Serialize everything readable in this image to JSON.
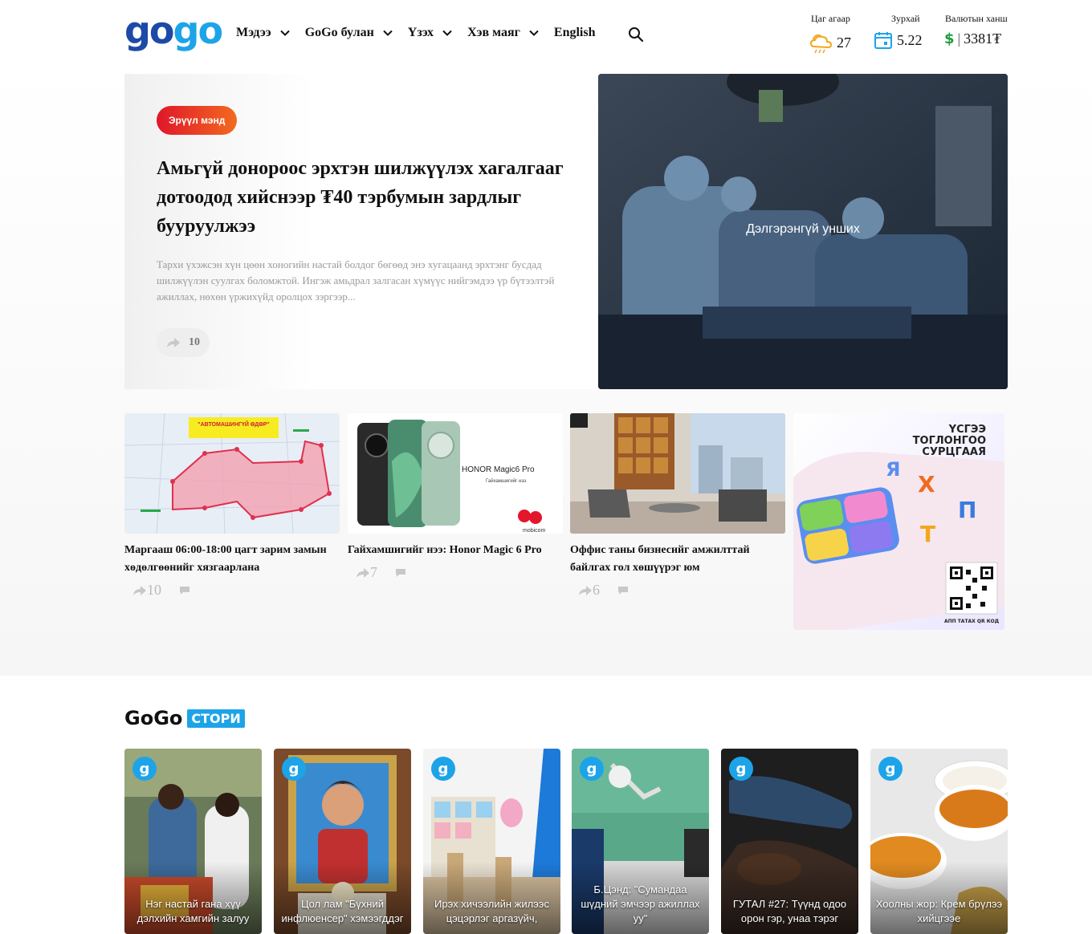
{
  "header": {
    "logo_part1": "go",
    "logo_part2": "go",
    "nav": [
      {
        "label": "Мэдээ"
      },
      {
        "label": "GoGo булан"
      },
      {
        "label": "Үзэх"
      },
      {
        "label": "Хэв маяг"
      },
      {
        "label": "English"
      }
    ],
    "widgets": {
      "weather_label": "Цаг агаар",
      "weather_value": "27",
      "calendar_label": "Зурхай",
      "calendar_value": "5.22",
      "currency_label": "Валютын ханш",
      "currency_value": "3381₮",
      "currency_symbol": "$"
    }
  },
  "hero": {
    "category": "Эрүүл мэнд",
    "title": "Амьгүй донороос эрхтэн шилжүүлэх хагалгааг дотоодод хийснээр ₮40 тэрбумын зардлыг бууруулжээ",
    "description": "Тархи үхэжсэн хүн цөөн хоногийн настай болдог бөгөөд энэ хугацаанд эрхтэнг бусдад шилжүүлэн суулгах боломжтой. Ингэж амьдрал залгасан хүмүүс нийгэмдээ үр бүтээлтэй ажиллах, нөхөн үржихүйд оролцох зэргээр...",
    "shares": "10",
    "read_more": "Дэлгэрэнгүй унших"
  },
  "cards": [
    {
      "title": "Маргааш 06:00-18:00 цагт зарим замын хөдөлгөөнийг хязгаарлана",
      "shares": "10",
      "map_banner": "\"АВТОМАШИНГҮЙ ӨДӨР\""
    },
    {
      "title": "Гайхамшигийг нээ: Honor Magic 6 Pro",
      "shares": "7",
      "ad_brand": "HONOR Magic6 Pro",
      "ad_sub": "Гайхамшигийг нээ",
      "ad_logo": "mobicom"
    },
    {
      "title": "Оффис таны бизнесийг амжилттай байлгах гол хөшүүрэг юм",
      "shares": "6"
    }
  ],
  "ad": {
    "line1": "ҮСГЭЭ",
    "line2": "ТОГЛОНГОО",
    "line3": "СУРЦГААЯ",
    "qr_label": "АПП ТАТАХ QR КОД"
  },
  "stories": {
    "title_main": "GoGo",
    "title_tag": "СТОРИ",
    "items": [
      {
        "caption": "Нэг настай гана хүү дэлхийн хамгийн залуу"
      },
      {
        "caption": "Цол лам \"Бүхний инфлюенсер\" хэмээгддэг"
      },
      {
        "caption": "Ирэх хичээлийн жилээс цэцэрлэг аргазүйч,"
      },
      {
        "caption": "Б.Цэнд: \"Сумандаа шүдний эмчээр ажиллах уу\""
      },
      {
        "caption": "ГУТАЛ #27: Түүнд одоо орон гэр, унаа тэрэг"
      },
      {
        "caption": "Хоолны жор: Крем брүлээ хийцгээе"
      }
    ]
  }
}
